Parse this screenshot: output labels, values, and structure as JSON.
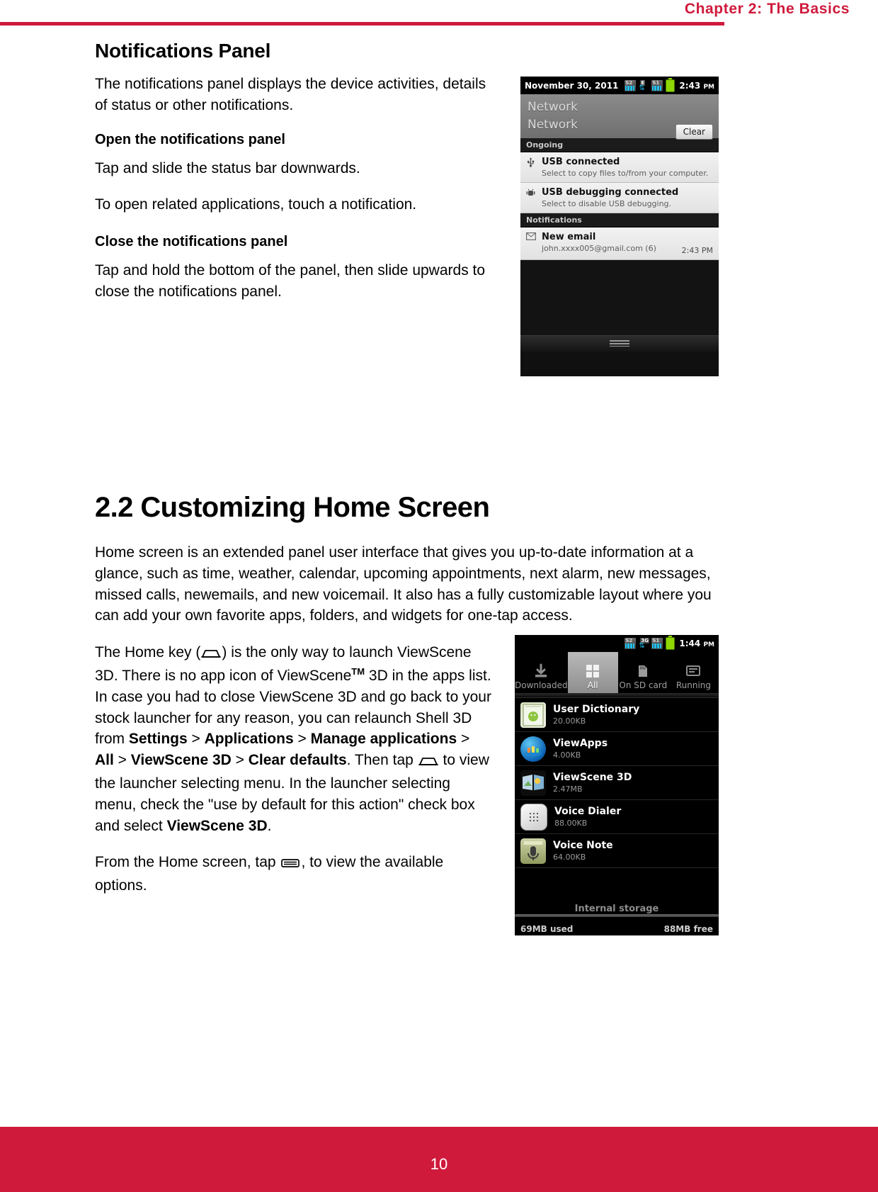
{
  "header": {
    "chapter_title": "Chapter 2: The Basics",
    "rule_color": "#cf1a3c"
  },
  "footer": {
    "page_number": "10",
    "band_color": "#cf1a3c"
  },
  "sections": {
    "notifications_panel": {
      "title": "Notifications Panel",
      "intro": "The notifications panel displays the device activities, details of status or other notifications.",
      "open_heading": "Open the notifications panel",
      "open_line1": "Tap and slide the status bar downwards.",
      "open_line2": "To open related applications, touch a notification.",
      "close_heading": "Close the notifications panel",
      "close_text": "Tap and hold the bottom of the panel, then slide upwards to close the notifications panel."
    },
    "customizing_home": {
      "title": "2.2 Customizing Home Screen",
      "paragraph1": "Home screen is an extended panel user interface that gives you up-to-date information at a glance, such as time, weather, calendar, upcoming appointments, next alarm, new messages, missed calls, newemails, and new voicemail. It also has a fully customizable layout where you can add your own favorite apps, folders, and widgets for one-tap access.",
      "paragraph2_a": "The Home key (",
      "paragraph2_b": ") is the only way to launch ViewScene 3D. There is no app icon of ViewScene",
      "paragraph2_tm": "TM",
      "paragraph2_c": " 3D in the apps list. In case you had to close ViewScene 3D and go back to your stock launcher for any reason, you can relaunch Shell 3D from ",
      "bold_settings": "Settings",
      "sep": " > ",
      "bold_applications": "Applications",
      "bold_manage_applications": "Manage applications",
      "bold_all": "All",
      "bold_viewscene3d": "ViewScene 3D",
      "bold_clear_defaults": "Clear defaults",
      "paragraph2_d": ". Then tap ",
      "paragraph2_e": " to view the launcher selecting menu. In the launcher selecting menu, check the \"use by default for this action\" check box and select ",
      "paragraph2_f": ".",
      "paragraph3_a": "From the Home screen, tap ",
      "paragraph3_b": ", to view the available options."
    }
  },
  "screenshot_notifications": {
    "status_bar": {
      "date": "November 30, 2011",
      "time": "2:43",
      "time_suffix": "PM",
      "signal1_label": "S2",
      "data_label": "E",
      "signal2_label": "S1"
    },
    "carrier_line1": "Network",
    "carrier_line2": "Network",
    "clear_button": "Clear",
    "section_ongoing": "Ongoing",
    "section_notifications": "Notifications",
    "items": [
      {
        "icon": "usb-icon",
        "title": "USB connected",
        "subtitle": "Select to copy files to/from your computer.",
        "time": ""
      },
      {
        "icon": "android-bug-icon",
        "title": "USB debugging connected",
        "subtitle": "Select to disable USB debugging.",
        "time": ""
      },
      {
        "icon": "mail-icon",
        "title": "New email",
        "subtitle": "john.xxxx005@gmail.com (6)",
        "time": "2:43 PM"
      }
    ]
  },
  "screenshot_apps": {
    "status_bar": {
      "time": "1:44",
      "time_suffix": "PM",
      "signal1_label": "S2",
      "data_label": "3G",
      "signal2_label": "S1"
    },
    "tabs": [
      {
        "label": "Downloaded",
        "icon": "download-icon",
        "active": false
      },
      {
        "label": "All",
        "icon": "grid-icon",
        "active": true
      },
      {
        "label": "On SD card",
        "icon": "sdcard-icon",
        "active": false
      },
      {
        "label": "Running",
        "icon": "running-icon",
        "active": false
      }
    ],
    "apps": [
      {
        "name": "User Dictionary",
        "size": "20.00KB",
        "icon": "user-dictionary-icon"
      },
      {
        "name": "ViewApps",
        "size": "4.00KB",
        "icon": "viewapps-icon"
      },
      {
        "name": "ViewScene 3D",
        "size": "2.47MB",
        "icon": "viewscene3d-icon"
      },
      {
        "name": "Voice Dialer",
        "size": "88.00KB",
        "icon": "voice-dialer-icon"
      },
      {
        "name": "Voice Note",
        "size": "64.00KB",
        "icon": "voice-note-icon"
      }
    ],
    "storage_label": "Internal storage",
    "storage_used": "69MB used",
    "storage_free": "88MB free"
  }
}
